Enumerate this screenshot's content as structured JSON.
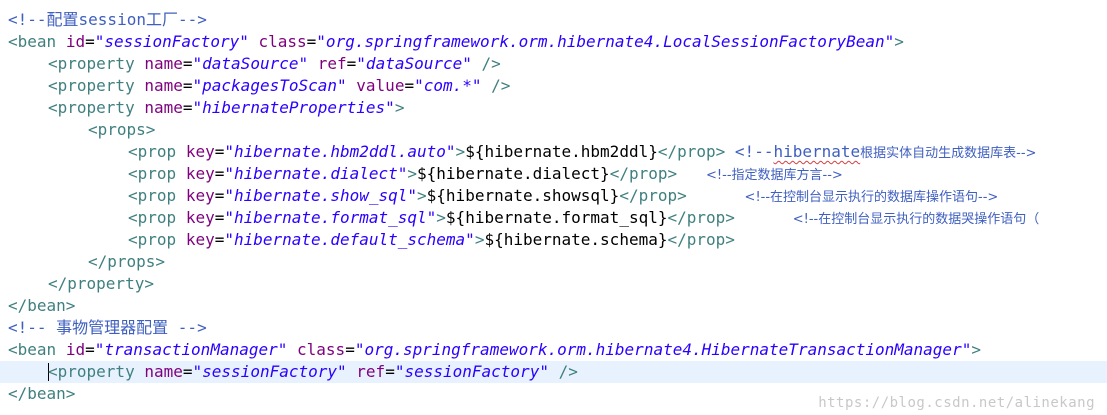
{
  "colors": {
    "comment": "#3f5fbf",
    "tag": "#3f7f7f",
    "attr_name": "#7f007f",
    "attr_value": "#2a00ff",
    "text": "#000000",
    "current_line": "#e8f2fe"
  },
  "code": {
    "l1": {
      "comment": "<!--配置session工厂-->"
    },
    "l2": {
      "open": "<bean",
      "a1": "id",
      "eq1": "=",
      "v1": "\"sessionFactory\"",
      "a2": "class",
      "eq2": "=",
      "v2": "\"org.springframework.orm.hibernate4.LocalSessionFactoryBean\"",
      "close": ">"
    },
    "l3": {
      "open": "<property",
      "a1": "name",
      "eq1": "=",
      "v1": "\"dataSource\"",
      "a2": "ref",
      "eq2": "=",
      "v2": "\"dataSource\"",
      "close": "/>"
    },
    "l4": {
      "open": "<property",
      "a1": "name",
      "eq1": "=",
      "v1": "\"packagesToScan\"",
      "a2": "value",
      "eq2": "=",
      "v2": "\"com.*\"",
      "close": "/>"
    },
    "l5": {
      "open": "<property",
      "a1": "name",
      "eq1": "=",
      "v1": "\"hibernateProperties\"",
      "close": ">"
    },
    "l6": {
      "tag": "<props>"
    },
    "l7": {
      "open": "<prop",
      "a1": "key",
      "eq1": "=",
      "v1": "\"hibernate.hbm2ddl.auto\"",
      "close": ">",
      "text": "${hibernate.hbm2ddl}",
      "end": "</prop>",
      "c_open": "<!--",
      "c_word": "hibernate",
      "c_rest": "根据实体自动生成数据库表-->"
    },
    "l8": {
      "open": "<prop",
      "a1": "key",
      "eq1": "=",
      "v1": "\"hibernate.dialect\"",
      "close": ">",
      "text": "${hibernate.dialect}",
      "end": "</prop>",
      "comment": "<!--指定数据库方言-->"
    },
    "l9": {
      "open": "<prop",
      "a1": "key",
      "eq1": "=",
      "v1": "\"hibernate.show_sql\"",
      "close": ">",
      "text": "${hibernate.showsql}",
      "end": "</prop>",
      "comment": "<!--在控制台显示执行的数据库操作语句-->"
    },
    "l10": {
      "open": "<prop",
      "a1": "key",
      "eq1": "=",
      "v1": "\"hibernate.format_sql\"",
      "close": ">",
      "text": "${hibernate.format_sql}",
      "end": "</prop>",
      "comment": "<!--在控制台显示执行的数据哭操作语句（"
    },
    "l11": {
      "open": "<prop",
      "a1": "key",
      "eq1": "=",
      "v1": "\"hibernate.default_schema\"",
      "close": ">",
      "text": "${hibernate.schema}",
      "end": "</prop>"
    },
    "l12": {
      "tag": "</props>"
    },
    "l13": {
      "tag": "</property>"
    },
    "l14": {
      "tag": "</bean>"
    },
    "l15": {
      "comment": "<!-- 事物管理器配置 -->"
    },
    "l16": {
      "open": "<bean",
      "a1": "id",
      "eq1": "=",
      "v1": "\"transactionManager\"",
      "a2": "class",
      "eq2": "=",
      "v2": "\"org.springframework.orm.hibernate4.HibernateTransactionManager\"",
      "close": ">"
    },
    "l17": {
      "open": "<property",
      "a1": "name",
      "eq1": "=",
      "v1": "\"sessionFactory\"",
      "a2": "ref",
      "eq2": "=",
      "v2": "\"sessionFactory\"",
      "close": "/>"
    },
    "l18": {
      "tag": "</bean>"
    }
  },
  "watermark": "https://blog.csdn.net/alinekang"
}
